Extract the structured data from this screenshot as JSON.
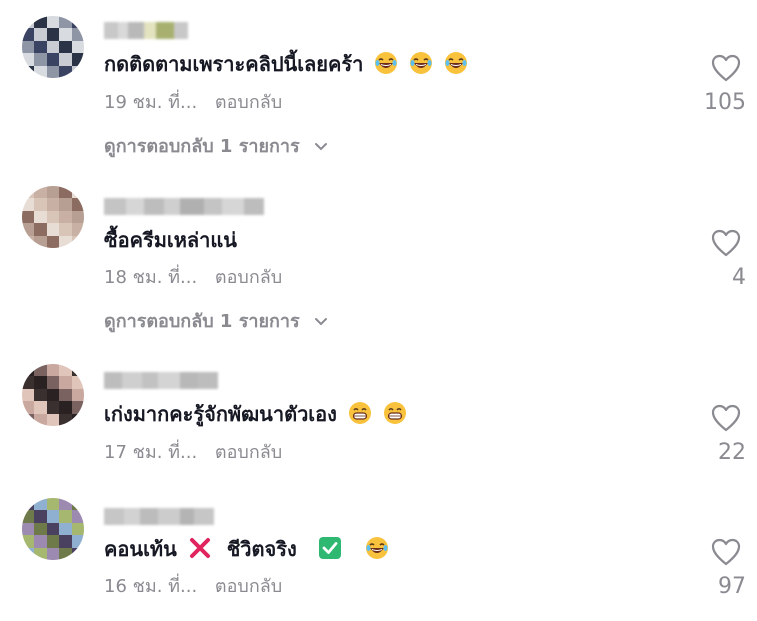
{
  "comments": [
    {
      "text": "กดติดตามเพราะคลิปนี้เลยคร้า",
      "emojis": [
        "laughing-emoji",
        "laughing-emoji",
        "laughing-emoji"
      ],
      "time": "19 ชม. ที่...",
      "reply_label": "ตอบกลับ",
      "view_replies": "ดูการตอบกลับ 1 รายการ",
      "likes": "105",
      "avatar_colors": [
        "#c9ccd3",
        "#8e96a6",
        "#2b3347",
        "#3a4361",
        "#d8dbe0"
      ],
      "name_colors": [
        "#c8c8c8",
        "#d9d9d9",
        "#b9b9b9",
        "#e3e3c0",
        "#a8b070"
      ]
    },
    {
      "text": "ซื้อครีมเหล่าแน่",
      "emojis": [],
      "time": "18 ชม. ที่...",
      "reply_label": "ตอบกลับ",
      "view_replies": "ดูการตอบกลับ 1 รายการ",
      "likes": "4",
      "avatar_colors": [
        "#b79f94",
        "#d9c4b8",
        "#8c6b60",
        "#c9b0a4",
        "#e8ddd5"
      ],
      "name_colors": [
        "#c4c4c4",
        "#d6d6d6",
        "#bdbdbd",
        "#cfcfcf",
        "#b0b0b0"
      ]
    },
    {
      "text": "เก่งมากคะรู้จักพัฒนาตัวเอง",
      "emojis": [
        "grinning-emoji",
        "grinning-emoji"
      ],
      "time": "17 ชม. ที่...",
      "reply_label": "ตอบกลับ",
      "likes": "22",
      "avatar_colors": [
        "#3a3030",
        "#c9a8a0",
        "#2a2222",
        "#e0c5bb",
        "#7a6260"
      ],
      "name_colors": [
        "#bdbdbd",
        "#cfcfcf",
        "#c2c2c2",
        "#d4d4d4",
        "#b8b8b8"
      ]
    },
    {
      "text_part1": "คอนเท้น",
      "text_part2": "ชีวิตจริง",
      "time": "16 ชม. ที่...",
      "reply_label": "ตอบกลับ",
      "likes": "97",
      "avatar_colors": [
        "#8fb0d0",
        "#6e7a4a",
        "#a6b870",
        "#4a4060",
        "#9c8ab0"
      ],
      "name_colors": [
        "#c6c6c6",
        "#d2d2d2",
        "#bcbcbc",
        "#cccccc",
        "#b4b4b4"
      ]
    }
  ],
  "colors": {
    "text_primary": "#161823",
    "text_secondary": "#8a8b91",
    "cross": "#e0245e",
    "check": "#2eb872"
  }
}
